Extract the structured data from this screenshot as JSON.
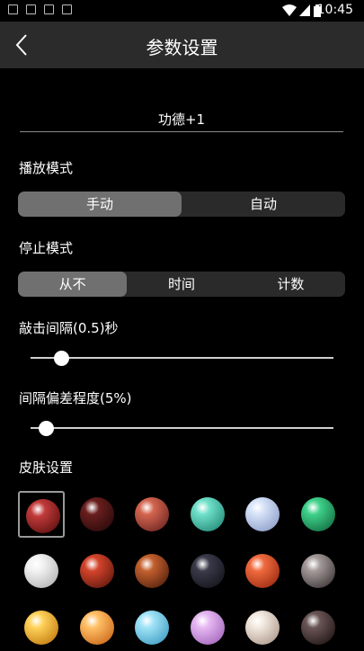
{
  "status_bar": {
    "time": "10:45",
    "left_icons": [
      "message-icon",
      "image-icon",
      "app-icon",
      "a-icon"
    ],
    "right_icons": [
      "wifi-icon",
      "signal-icon",
      "battery-icon"
    ]
  },
  "header": {
    "title": "参数设置",
    "back_icon": "back-arrow-icon"
  },
  "preset": {
    "value": "功德+1"
  },
  "play_mode": {
    "label": "播放模式",
    "options": [
      "手动",
      "自动"
    ],
    "selected": "手动"
  },
  "stop_mode": {
    "label": "停止模式",
    "options": [
      "从不",
      "时间",
      "计数"
    ],
    "selected": "从不"
  },
  "tap_interval": {
    "label": "敲击间隔(0.5)秒",
    "level": 0.1
  },
  "interval_deviation": {
    "label": "间隔偏差程度(5%)",
    "level": 0.05
  },
  "skin": {
    "label": "皮肤设置",
    "selected_index": 0,
    "beads": [
      {
        "name": "dark-red-bead",
        "c1": "#c23a3a",
        "c2": "#4a0808"
      },
      {
        "name": "dark-brown-bead",
        "c1": "#6a1e1e",
        "c2": "#1c0606"
      },
      {
        "name": "red-jasper-bead",
        "c1": "#d4654f",
        "c2": "#5a1a1a"
      },
      {
        "name": "turquoise-carved-bead",
        "c1": "#6fe0c9",
        "c2": "#177a6a"
      },
      {
        "name": "blue-lace-agate-bead",
        "c1": "#d6e2f7",
        "c2": "#7d8fbf"
      },
      {
        "name": "malachite-bead",
        "c1": "#3fd18a",
        "c2": "#0a5a33"
      },
      {
        "name": "white-jade-bead",
        "c1": "#f2f2f2",
        "c2": "#a8a8a8"
      },
      {
        "name": "dragon-carved-bead",
        "c1": "#d4442b",
        "c2": "#4a1008"
      },
      {
        "name": "amber-mantra-bead",
        "c1": "#c3602e",
        "c2": "#3f1408"
      },
      {
        "name": "black-mantra-bead",
        "c1": "#3a3a4a",
        "c2": "#0d0d14"
      },
      {
        "name": "red-agate-bead",
        "c1": "#f06a3e",
        "c2": "#8a1e08"
      },
      {
        "name": "obsidian-bead",
        "c1": "#a59a9a",
        "c2": "#2a2424"
      },
      {
        "name": "yellow-amber-bead",
        "c1": "#ffd25a",
        "c2": "#b56a00"
      },
      {
        "name": "orange-striped-bead",
        "c1": "#ffc066",
        "c2": "#c2560a"
      },
      {
        "name": "sky-blue-bead",
        "c1": "#9fe3f7",
        "c2": "#2d8fb8"
      },
      {
        "name": "lavender-bead",
        "c1": "#e6b8f2",
        "c2": "#9556b0"
      },
      {
        "name": "pink-marble-bead",
        "c1": "#f2e8df",
        "c2": "#a08a7a"
      },
      {
        "name": "black-onyx-bead",
        "c1": "#6a5555",
        "c2": "#140a0a"
      }
    ]
  }
}
